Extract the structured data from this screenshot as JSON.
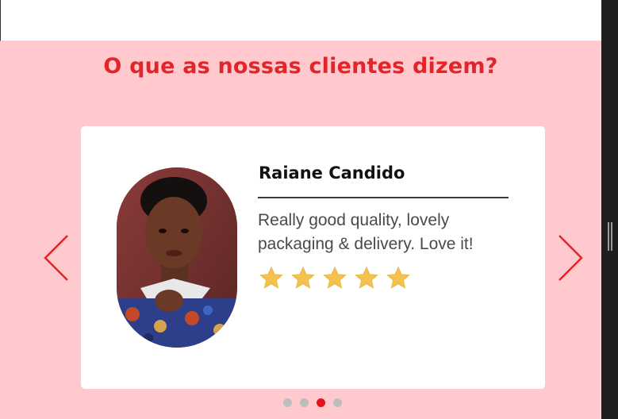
{
  "section": {
    "title": "O que as nossas clientes dizem?"
  },
  "testimonial": {
    "name": "Raiane Candido",
    "text": "Really good quality, lovely packaging & delivery. Love it!",
    "rating": 5,
    "rating_max": 5,
    "star_color": "#f2c14e",
    "photo_icon": "woman-portrait-photo"
  },
  "carousel": {
    "prev_icon": "chevron-left-icon",
    "next_icon": "chevron-right-icon",
    "slide_count": 4,
    "active_index": 2,
    "accent_color": "#e3242b"
  },
  "colors": {
    "section_background": "#ffc9ce",
    "title": "#e3242b",
    "dot_inactive": "#bdbdbd",
    "dot_active": "#e0141b"
  }
}
